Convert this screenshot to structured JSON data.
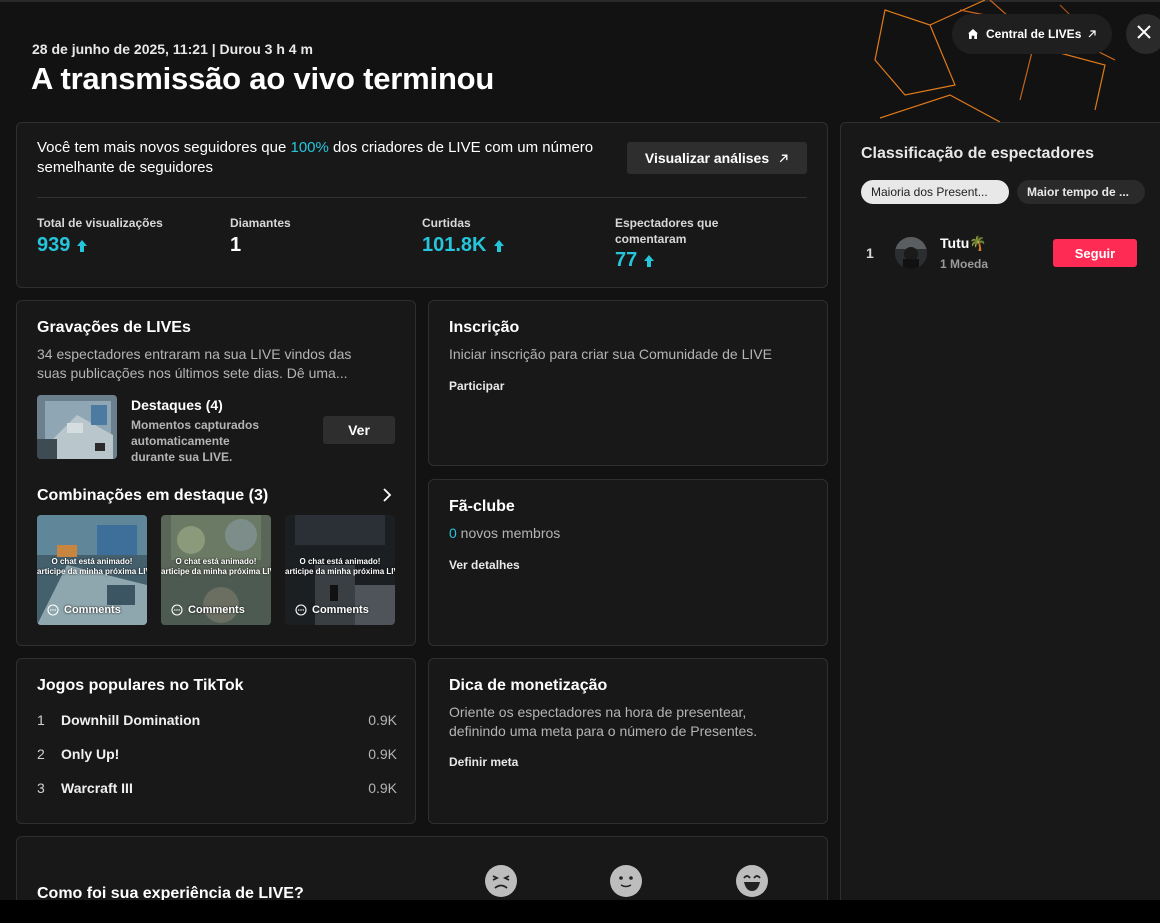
{
  "header": {
    "subtitle": "28 de junho de 2025, 11:21 | Durou 3 h 4 m",
    "title": "A transmissão ao vivo terminou",
    "central_label": "Central de LIVEs",
    "icons": {
      "central": "home-icon",
      "external": "external-link-icon",
      "close": "close-icon"
    }
  },
  "stats": {
    "message_before": "Você tem mais novos seguidores que ",
    "message_highlight": "100%",
    "message_after": " dos criadores de LIVE com um número semelhante de seguidores",
    "analytics_button": "Visualizar análises",
    "items": [
      {
        "label": "Total de visualizações",
        "value": "939",
        "trend": "up"
      },
      {
        "label": "Diamantes",
        "value": "1",
        "trend": "none"
      },
      {
        "label": "Curtidas",
        "value": "101.8K",
        "trend": "up"
      },
      {
        "label": "Espectadores que comentaram",
        "value": "77",
        "trend": "up"
      }
    ],
    "colors": {
      "highlight": "#25c5dc",
      "accent_pink": "#fe2c55"
    }
  },
  "recordings": {
    "title": "Gravações de LIVEs",
    "description": "34 espectadores entraram na sua LIVE vindos das suas publicações nos últimos sete dias. Dê uma...",
    "highlights_title": "Destaques (4)",
    "highlights_desc": "Momentos capturados automaticamente durante sua LIVE.",
    "view_button": "Ver",
    "combos_title": "Combinações em destaque (3)",
    "clips": [
      {
        "caption1": "O chat está animado!",
        "caption2": "articipe da minha próxima LIV",
        "comments": "Comments"
      },
      {
        "caption1": "O chat está animado!",
        "caption2": "articipe da minha próxima LIV",
        "comments": "Comments"
      },
      {
        "caption1": "O chat está animado!",
        "caption2": "articipe da minha próxima LIV",
        "comments": "Comments"
      }
    ]
  },
  "subscription": {
    "title": "Inscrição",
    "description": "Iniciar inscrição para criar sua Comunidade de LIVE",
    "action": "Participar"
  },
  "fanclub": {
    "title": "Fã-clube",
    "count": "0",
    "count_label": " novos membros",
    "action": "Ver detalhes"
  },
  "games": {
    "title": "Jogos populares no TikTok",
    "items": [
      {
        "rank": "1",
        "name": "Downhill Domination",
        "count": "0.9K"
      },
      {
        "rank": "2",
        "name": "Only Up!",
        "count": "0.9K"
      },
      {
        "rank": "3",
        "name": "Warcraft III",
        "count": "0.9K"
      }
    ]
  },
  "monetization": {
    "title": "Dica de monetização",
    "description": "Oriente os espectadores na hora de presentear, definindo uma meta para o número de Presentes.",
    "action": "Definir meta"
  },
  "feedback": {
    "question": "Como foi sua experiência de LIVE?",
    "options": [
      "sad-face-icon",
      "neutral-face-icon",
      "happy-face-icon"
    ]
  },
  "ranking": {
    "title": "Classificação de espectadores",
    "tabs": [
      {
        "label": "Maioria dos Presentes",
        "display": "Maioria dos Present...",
        "active": true
      },
      {
        "label": "Maior tempo de assistir",
        "display": "Maior tempo de ...",
        "active": false
      }
    ],
    "viewers": [
      {
        "rank": "1",
        "name": "Tutu🌴",
        "sub": "1 Moeda",
        "follow": "Seguir"
      }
    ]
  }
}
